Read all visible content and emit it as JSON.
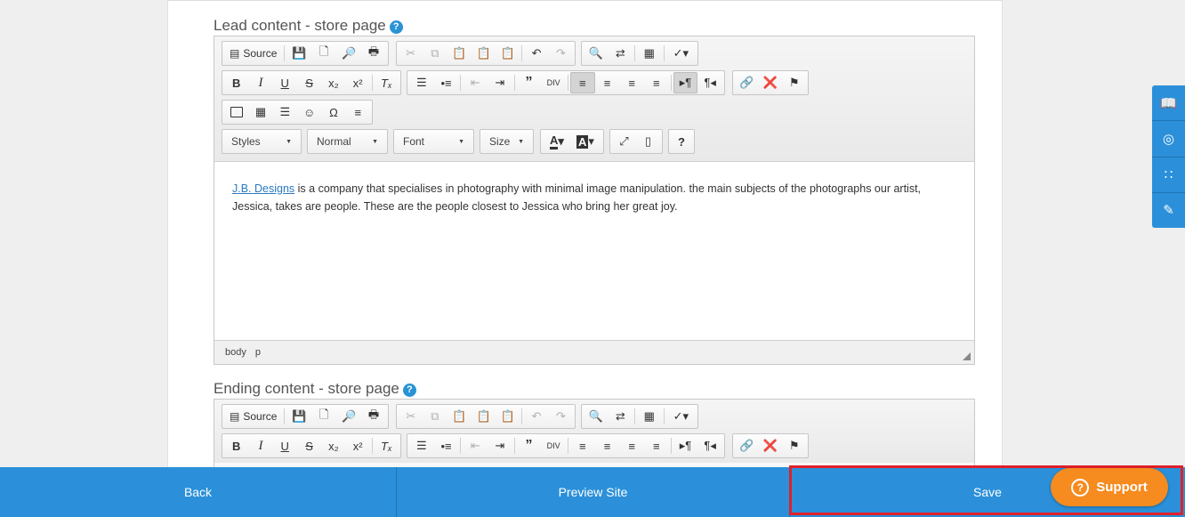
{
  "sections": {
    "lead_title": "Lead content - store page",
    "ending_title": "Ending content - store page",
    "help_glyph": "?"
  },
  "toolbar": {
    "source_label": "Source",
    "styles_label": "Styles",
    "format_label": "Normal",
    "font_label": "Font",
    "size_label": "Size",
    "help_label": "?"
  },
  "lead_editor": {
    "link_text": "J.B. Designs",
    "body_text": " is a company that specialises in photography with minimal image manipulation. the main subjects of the photographs our artist, Jessica, takes are people. These are the people closest to Jessica who bring her great joy.",
    "path": [
      "body",
      "p"
    ]
  },
  "bottom_bar": {
    "back_label": "Back",
    "preview_label": "Preview Site",
    "save_label": "Save"
  },
  "support": {
    "label": "Support"
  },
  "side_tabs": [
    "book-icon",
    "lifebuoy-icon",
    "rss-icon",
    "edit-icon"
  ],
  "colors": {
    "accent_blue": "#2b90d9",
    "support_orange": "#f68b1f",
    "highlight_red": "#e0202a"
  }
}
